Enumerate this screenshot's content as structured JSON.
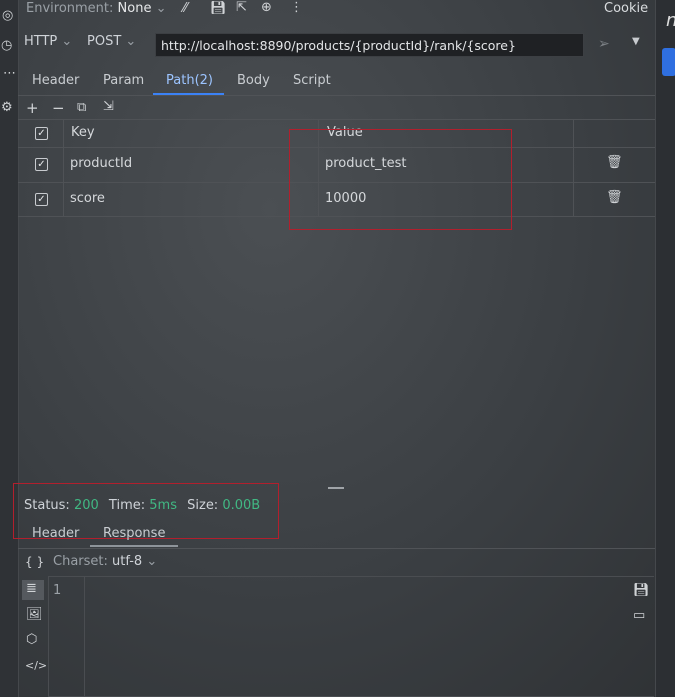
{
  "toolbar": {
    "environment_label": "Environment:",
    "environment_value": "None",
    "cookie": "Cookie"
  },
  "request": {
    "protocol": "HTTP",
    "method": "POST",
    "url": "http://localhost:8890/products/{productId}/rank/{score}"
  },
  "tabs": {
    "header": "Header",
    "param": "Param",
    "path": "Path",
    "path_count": "(2)",
    "body": "Body",
    "script": "Script"
  },
  "table": {
    "col_key": "Key",
    "col_value": "Value",
    "rows": [
      {
        "key": "productId",
        "value": "product_test",
        "checked": true
      },
      {
        "key": "score",
        "value": "10000",
        "checked": true
      }
    ]
  },
  "response": {
    "status_label": "Status:",
    "status_value": "200",
    "time_label": "Time:",
    "time_value": "5ms",
    "size_label": "Size:",
    "size_value": "0.00B",
    "tab_header": "Header",
    "tab_response": "Response",
    "charset_label": "Charset:",
    "charset_value": "utf-8",
    "line_number": "1"
  },
  "colors": {
    "accent": "#3b82f6",
    "status_green": "#41b883",
    "highlight_red": "#b21f2d"
  }
}
